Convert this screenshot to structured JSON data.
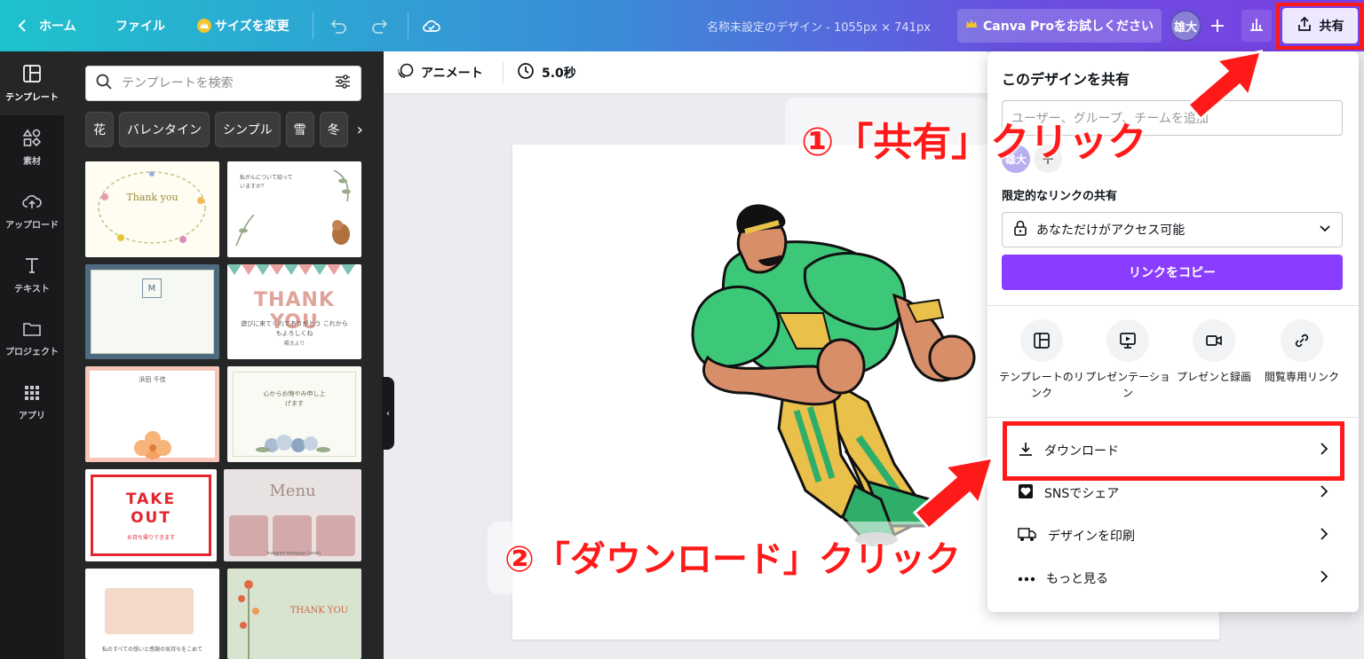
{
  "topbar": {
    "home_label": "ホーム",
    "file_label": "ファイル",
    "resize_label": "サイズを変更",
    "design_title": "名称未設定のデザイン - 1055px × 741px",
    "pro_label": "Canva Proをお試しください",
    "avatar_text": "雄大",
    "share_label": "共有"
  },
  "rail": {
    "items": [
      {
        "label": "テンプレート",
        "icon": "template-icon"
      },
      {
        "label": "素材",
        "icon": "elements-icon"
      },
      {
        "label": "アップロード",
        "icon": "upload-icon"
      },
      {
        "label": "テキスト",
        "icon": "text-icon"
      },
      {
        "label": "プロジェクト",
        "icon": "folder-icon"
      },
      {
        "label": "アプリ",
        "icon": "apps-icon"
      }
    ]
  },
  "panel": {
    "search_placeholder": "テンプレートを検索",
    "chips": [
      "花",
      "バレンタイン",
      "シンプル",
      "雪",
      "冬"
    ],
    "templates": [
      {
        "title": "Thank you"
      },
      {
        "title": "私がんについて知っていますか？"
      },
      {
        "title": "M"
      },
      {
        "title": "THANK YOU",
        "subtitle": "遊びに来てくれてありがとう これからもよろしくね",
        "sign": "陽汰より"
      },
      {
        "title": "浜田 千佳"
      },
      {
        "title": "心からお悔やみ申し上げます"
      },
      {
        "title": "TAKE OUT",
        "subtitle": "お持ち帰りできます"
      },
      {
        "title": "Menu",
        "subtitle": "Instagram Homepage Contact"
      },
      {
        "title": "私のすべての想いと感謝の気持ちをこめて"
      },
      {
        "title": "THANK YOU"
      }
    ]
  },
  "subtoolbar": {
    "animate_label": "アニメート",
    "duration_label": "5.0秒"
  },
  "share_panel": {
    "title": "このデザインを共有",
    "people_placeholder": "ユーザー、グループ、チームを追加",
    "mini_avatar": "雄大",
    "link_section_label": "限定的なリンクの共有",
    "access_value": "あなただけがアクセス可能",
    "copy_link_label": "リンクをコピー",
    "options": [
      {
        "label": "テンプレートのリンク",
        "icon": "template-link-icon"
      },
      {
        "label": "プレゼンテーション",
        "icon": "presentation-icon"
      },
      {
        "label": "プレゼンと録画",
        "icon": "record-icon"
      },
      {
        "label": "閲覧専用リンク",
        "icon": "view-link-icon"
      }
    ],
    "menu": [
      {
        "label": "ダウンロード",
        "icon": "download-icon"
      },
      {
        "label": "SNSでシェア",
        "icon": "heart-icon"
      },
      {
        "label": "デザインを印刷",
        "icon": "truck-icon"
      },
      {
        "label": "もっと見る",
        "icon": "more-icon"
      }
    ]
  },
  "annotations": {
    "step1": "①「共有」クリック",
    "step2": "②「ダウンロード」クリック"
  },
  "colors": {
    "accent_purple": "#8b3dff",
    "annotation_red": "#ff1a1a"
  }
}
